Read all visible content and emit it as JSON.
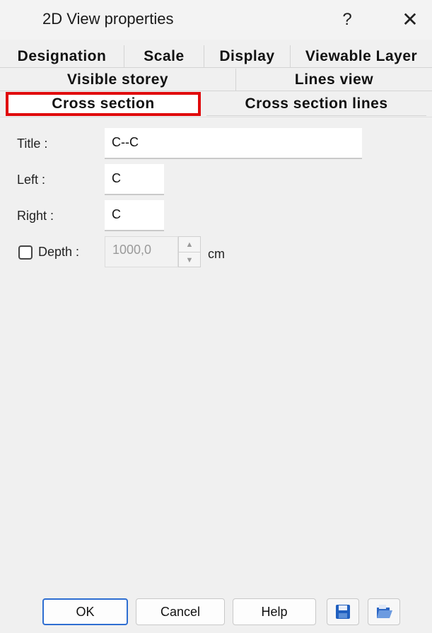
{
  "window": {
    "title": "2D View properties",
    "help": "?",
    "close": "✕"
  },
  "tabs": {
    "row1": [
      "Designation",
      "Scale",
      "Display",
      "Viewable Layer"
    ],
    "row2": [
      "Visible storey",
      "Lines view"
    ],
    "row3": [
      "Cross section",
      "Cross section lines"
    ],
    "active": "Cross section"
  },
  "form": {
    "title_label": "Title :",
    "title_value": "C--C",
    "left_label": "Left :",
    "left_value": "C",
    "right_label": "Right :",
    "right_value": "C",
    "depth_label": "Depth :",
    "depth_checked": false,
    "depth_value": "1000,0",
    "depth_unit": "cm"
  },
  "buttons": {
    "ok": "OK",
    "cancel": "Cancel",
    "help": "Help",
    "save_icon": "save-icon",
    "load_icon": "open-icon"
  },
  "colors": {
    "highlight": "#e0080b",
    "default_button_border": "#2e6ed1"
  }
}
